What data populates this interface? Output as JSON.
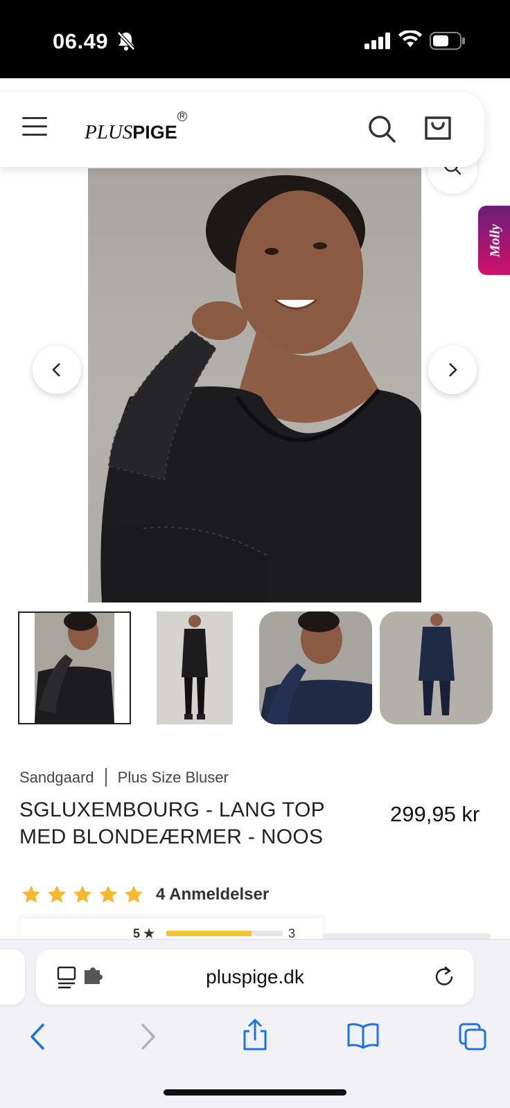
{
  "status_bar": {
    "time": "06.49",
    "icons": [
      "bell-slash-icon",
      "signal-icon",
      "wifi-icon",
      "battery-icon"
    ]
  },
  "header": {
    "logo_plus": "PLUS",
    "logo_pige": "PIGE",
    "logo_reg": "R",
    "icons": [
      "menu-icon",
      "search-icon",
      "cart-icon"
    ]
  },
  "gallery": {
    "chat_widget_label": "Molly",
    "thumbnails": [
      "thumbnail-1",
      "thumbnail-2",
      "thumbnail-3",
      "thumbnail-4"
    ],
    "selected_thumbnail": 1
  },
  "product": {
    "brand": "Sandgaard",
    "category": "Plus Size Bluser",
    "title": "SGLUXEMBOURG - LANG TOP MED BLONDEÆRMER - NOOS",
    "price": "299,95 kr",
    "rating_stars": 5,
    "reviews_label": "4 Anmeldelser",
    "breakdown": {
      "star_label": "5 ★",
      "fill_fraction": 0.73,
      "count": "3"
    }
  },
  "browser": {
    "url": "pluspige.dk",
    "icons": [
      "reader-icon",
      "extension-icon",
      "reload-icon",
      "back-icon",
      "forward-icon",
      "share-icon",
      "bookmarks-icon",
      "tabs-icon"
    ]
  },
  "colors": {
    "star": "#F5B82E",
    "accent_blue": "#1A73E8",
    "chat_gradient_start": "#6A1E7A",
    "chat_gradient_end": "#D0106A"
  }
}
